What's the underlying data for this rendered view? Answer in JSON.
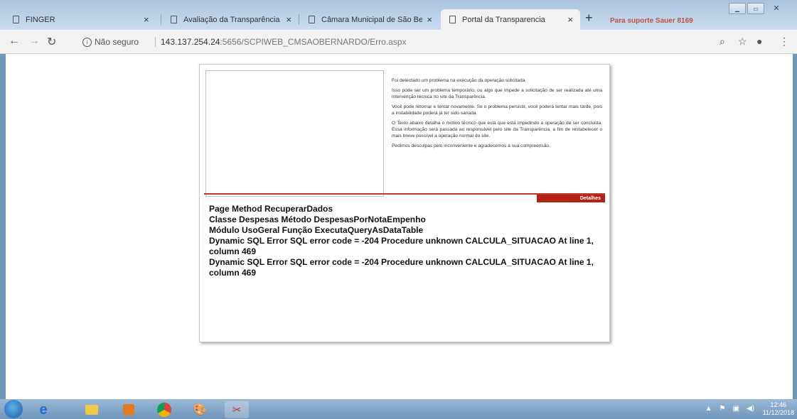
{
  "tabs": [
    {
      "label": "FINGER",
      "active": false
    },
    {
      "label": "Avaliação da Transparência dos :",
      "active": false
    },
    {
      "label": "Câmara Municipal de São Berdar",
      "active": false
    },
    {
      "label": "Portal da Transparencia",
      "active": true
    }
  ],
  "browser": {
    "new_tab": "+",
    "insecure_label": "Não seguro",
    "url_host": "143.137.254.24",
    "url_path": ":5656/SCPIWEB_CMSAOBERNARDO/Erro.aspx",
    "banner_text": "Para suporte Sauer 8169"
  },
  "error_page": {
    "messages": [
      "Foi detectado um problema na execução da operação solicitada.",
      "Isso pode ser um problema temporário, ou algo que impede a solicitação de ser realizada até uma intervenção técnica no site da Transparência.",
      "Você pode retornar e tentar novamente. Se o problema persistir, você poderá tentar mais tarde, pois a instabilidade poderá já ter sido sanada.",
      "O Texto abaixo detalha o motivo técnico que está que está impedindo a operação de ser concluída. Essa informação será passada ao responsável pelo site da Transparência, a fim de restabelecer o mais breve possível a operação normal do site.",
      "Pedimos desculpas pelo inconveniente e agradecemos a sua compreensão."
    ],
    "details_label": "Detalhes",
    "details": [
      "Page Method RecuperarDados",
      "Classe Despesas Método DespesasPorNotaEmpenho",
      "Módulo UsoGeral Função ExecutaQueryAsDataTable",
      "Dynamic SQL Error SQL error code = -204 Procedure unknown CALCULA_SITUACAO At line 1, column 469",
      "Dynamic SQL Error SQL error code = -204 Procedure unknown CALCULA_SITUACAO At line 1, column 469"
    ]
  },
  "taskbar": {
    "time": "12:46",
    "date": "11/12/2018"
  }
}
